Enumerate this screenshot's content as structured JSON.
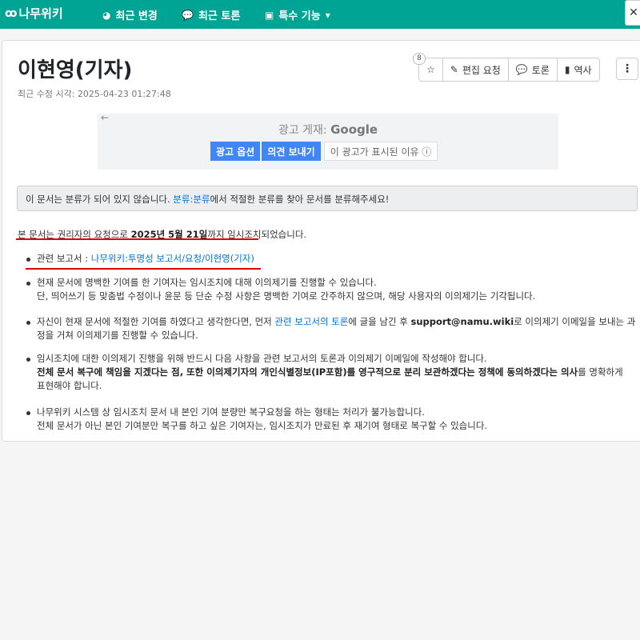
{
  "topbar": {
    "logo": "나무위키",
    "nav": [
      {
        "label": "최근 변경",
        "icon": "compass-icon"
      },
      {
        "label": "최근 토론",
        "icon": "comments-icon"
      },
      {
        "label": "특수 기능",
        "icon": "toolbox-icon"
      }
    ],
    "search_glyph": "✕"
  },
  "page": {
    "title": "이현영(기자)",
    "last_modified_label": "최근 수정 시각:",
    "last_modified": "2025-04-23 01:27:48",
    "star_count": "8",
    "actions": [
      {
        "label": "",
        "icon": "star-icon"
      },
      {
        "label": "편집 요청",
        "icon": "edit-user-icon"
      },
      {
        "label": "토론",
        "icon": "comments-icon"
      },
      {
        "label": "역사",
        "icon": "book-icon"
      }
    ],
    "more": "⋮"
  },
  "ad": {
    "back": "←",
    "label_prefix": "광고 게재:",
    "label_brand": "Google",
    "buttons": [
      "광고 옵션",
      "의견 보내기"
    ],
    "why": "이 광고가 표시된 이유 ⓘ"
  },
  "notice": {
    "pre": "이 문서는 분류가 되어 있지 않습니다. ",
    "link": "분류:분류",
    "post": "에서 적절한 분류를 찾아 문서를 분류해주세요!"
  },
  "content": {
    "p1_pre": "본 문서는 권리자의 요청으로 ",
    "p1_bold": "2025년 5월 21일",
    "p1_post": "까지 임시조치되었습니다.",
    "related_label": "관련 보고서 : ",
    "related_link": "나무위키:투명성 보고서/요청/이현영(기자)",
    "b2_l1": "현재 문서에 명백한 기여를 한 기여자는 임시조치에 대해 이의제기를 진행할 수 있습니다.",
    "b2_l2": "단, 띄어쓰기 등 맞춤법 수정이나 윤문 등 단순 수정 사항은 명백한 기여로 간주하지 않으며, 해당 사용자의 이의제기는 기각됩니다.",
    "b3_pre": "자신이 현재 문서에 적절한 기여를 하였다고 생각한다면, 먼저 ",
    "b3_link": "관련 보고서의 토론",
    "b3_mid": "에 글을 남긴 후 ",
    "b3_email": "support@namu.wiki",
    "b3_post": "로 이의제기 이메일을 보내는 과",
    "b3_l2": "정을 거쳐 이의제기를 진행할 수 있습니다.",
    "b4_l1": "임시조치에 대한 이의제기 진행을 위해 반드시 다음 사항을 관련 보고서의 토론과 이의제기 이메일에 작성해야 합니다.",
    "b4_bold": "전체 문서 복구에 책임을 지겠다는 점, 또한 이의제기자의 개인식별정보(IP포함)를 영구적으로 분리 보관하겠다는 정책에 동의하겠다는 의사",
    "b4_post": "를 명확하게",
    "b4_l3": "표현해야 합니다.",
    "b5_l1": "나무위키 시스템 상 임시조치 문서 내 본인 기여 분량만 복구요청을 하는 형태는 처리가 불가능합니다.",
    "b5_l2": "전체 문서가 아닌 본인 기여분만 복구를 하고 싶은 기여자는, 임시조치가 만료된 후 재기여 형태로 복구할 수 있습니다."
  }
}
